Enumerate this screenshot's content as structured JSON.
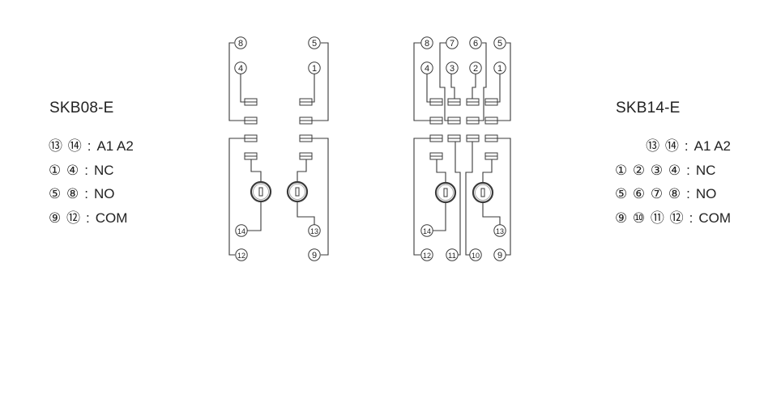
{
  "left_panel": {
    "title": "SKB08-E",
    "legend": [
      {
        "pins": "⑬ ⑭",
        "label": "A1  A2"
      },
      {
        "pins": "① ④",
        "label": "NC"
      },
      {
        "pins": "⑤ ⑧",
        "label": "NO"
      },
      {
        "pins": "⑨ ⑫",
        "label": "COM"
      }
    ]
  },
  "right_panel": {
    "title": "SKB14-E",
    "legend": [
      {
        "pins": "⑬ ⑭",
        "label": "A1  A2"
      },
      {
        "pins": "① ② ③ ④",
        "label": "NC"
      },
      {
        "pins": "⑤ ⑥ ⑦ ⑧",
        "label": "NO"
      },
      {
        "pins": "⑨ ⑩ ⑪ ⑫",
        "label": "COM"
      }
    ]
  },
  "separator": ":",
  "colors": {
    "line": "#3a3a3a",
    "text": "#222222",
    "background": "#ffffff"
  },
  "diagram_skb08": {
    "terminals": [
      "8",
      "5",
      "4",
      "1",
      "14",
      "13",
      "12",
      "9"
    ]
  },
  "diagram_skb14": {
    "terminals": [
      "8",
      "7",
      "6",
      "5",
      "4",
      "3",
      "2",
      "1",
      "14",
      "13",
      "12",
      "11",
      "10",
      "9"
    ]
  }
}
